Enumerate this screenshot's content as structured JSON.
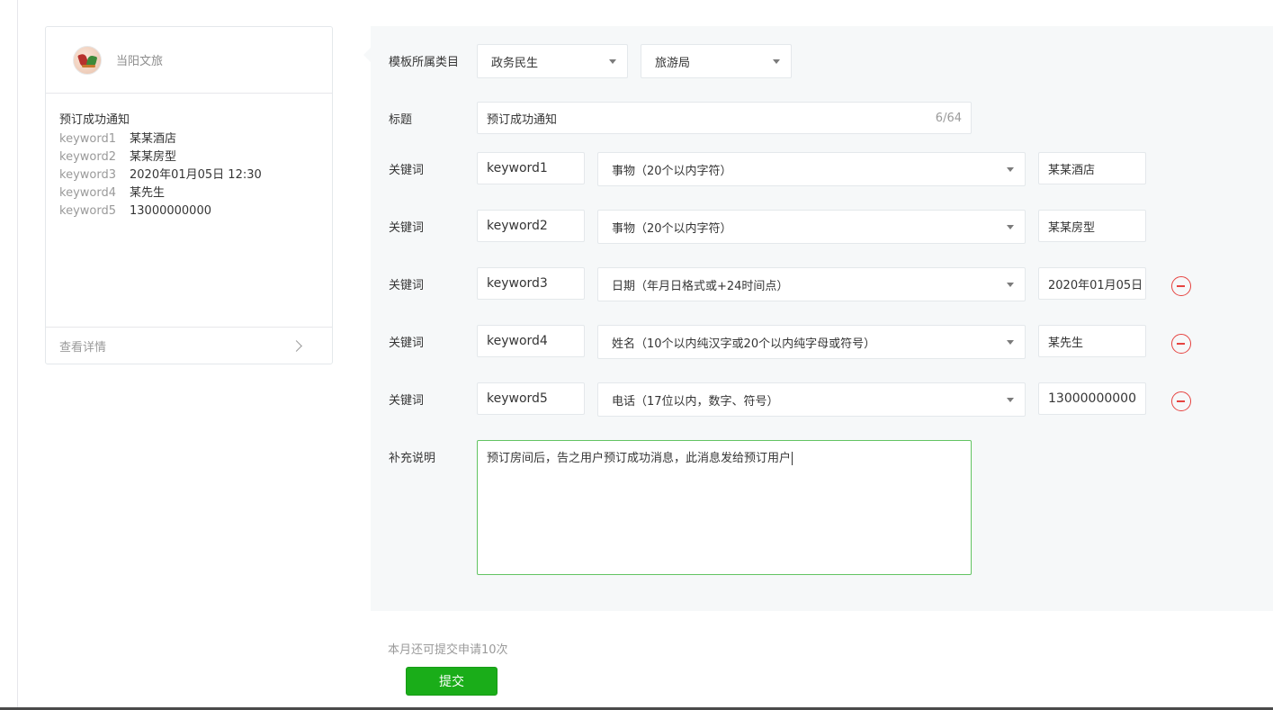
{
  "preview": {
    "account_name": "当阳文旅",
    "message_title": "预订成功通知",
    "keywords": [
      {
        "key": "keyword1",
        "value": "某某酒店"
      },
      {
        "key": "keyword2",
        "value": "某某房型"
      },
      {
        "key": "keyword3",
        "value": "2020年01月05日 12:30"
      },
      {
        "key": "keyword4",
        "value": "某先生"
      },
      {
        "key": "keyword5",
        "value": "13000000000"
      }
    ],
    "detail_link": "查看详情"
  },
  "form": {
    "category_label": "模板所属类目",
    "category_primary": "政务民生",
    "category_secondary": "旅游局",
    "title_label": "标题",
    "title_value": "预订成功通知",
    "title_counter": "6/64",
    "keyword_rows": [
      {
        "label": "关键词",
        "name": "keyword1",
        "type": "事物（20个以内字符）",
        "example": "某某酒店",
        "removable": false
      },
      {
        "label": "关键词",
        "name": "keyword2",
        "type": "事物（20个以内字符）",
        "example": "某某房型",
        "removable": false
      },
      {
        "label": "关键词",
        "name": "keyword3",
        "type": "日期（年月日格式或+24时间点）",
        "example": "2020年01月05日",
        "removable": true
      },
      {
        "label": "关键词",
        "name": "keyword4",
        "type": "姓名（10个以内纯汉字或20个以内纯字母或符号）",
        "example": "某先生",
        "removable": true
      },
      {
        "label": "关键词",
        "name": "keyword5",
        "type": "电话（17位以内，数字、符号）",
        "example": "13000000000",
        "removable": true
      }
    ],
    "description_label": "补充说明",
    "description_value": "预订房间后，告之用户预订成功消息，此消息发给预订用户"
  },
  "footer": {
    "quota_tip": "本月还可提交申请10次",
    "submit_label": "提交"
  },
  "colors": {
    "primary": "#1aad19",
    "danger": "#e64340",
    "focus_border": "#62c462",
    "panel_bg": "#f6f8f9"
  }
}
